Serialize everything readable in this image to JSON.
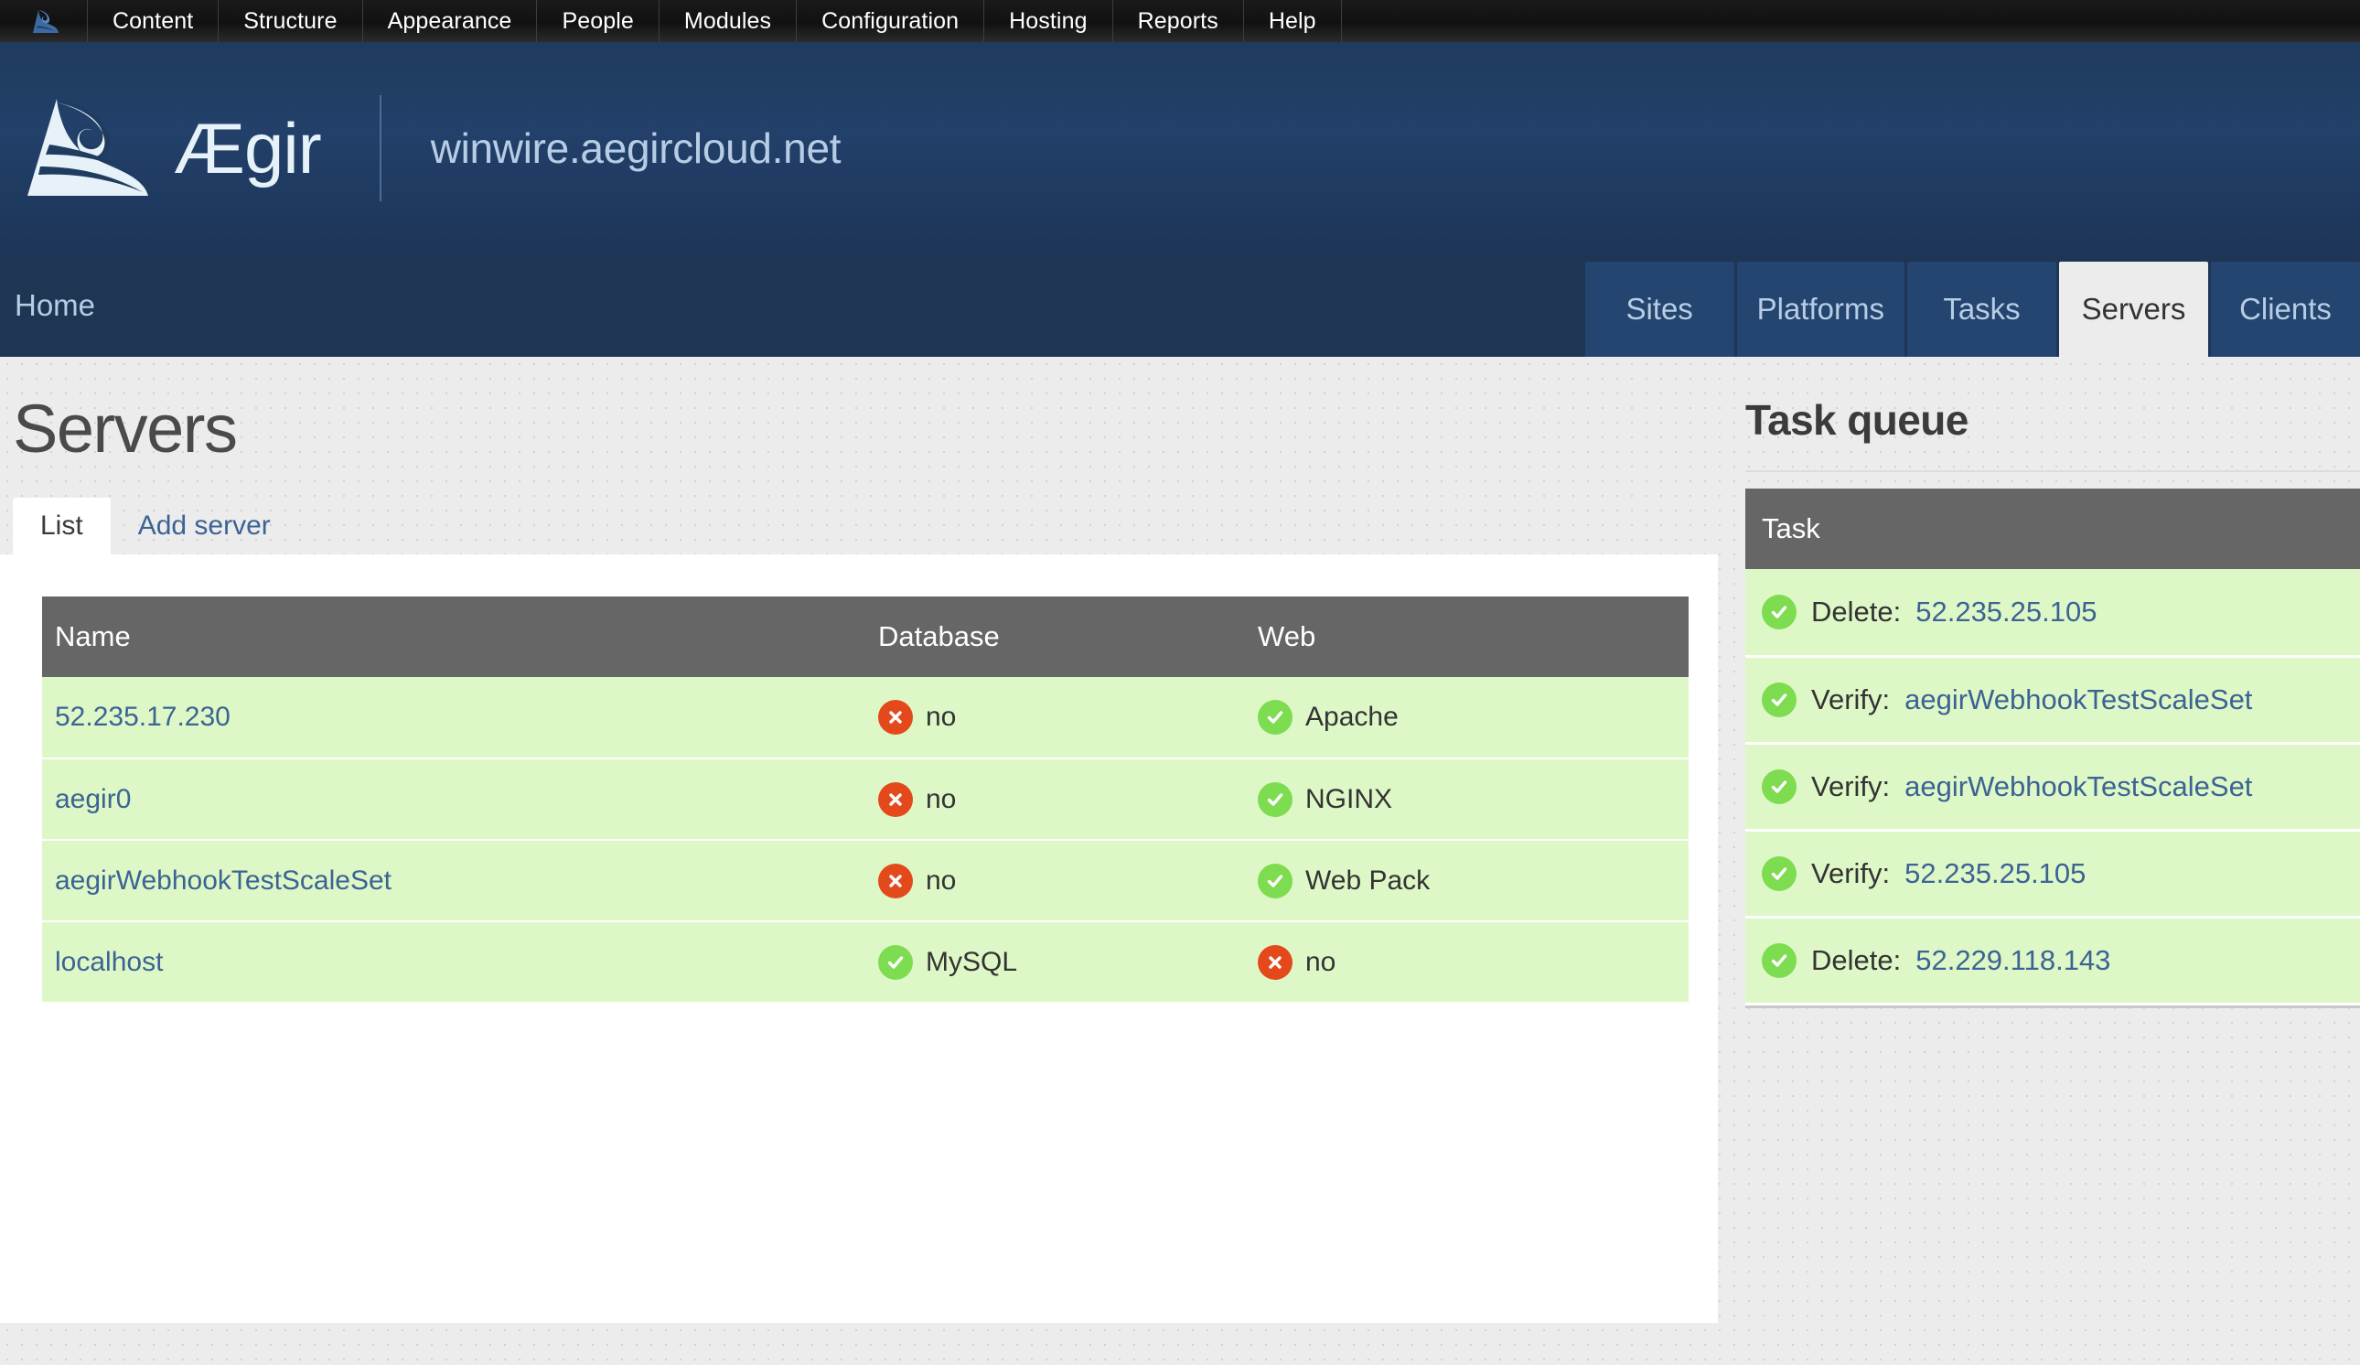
{
  "admin_toolbar": {
    "home_icon": "aegir-wave-logo-icon",
    "items": [
      {
        "label": "Content"
      },
      {
        "label": "Structure"
      },
      {
        "label": "Appearance"
      },
      {
        "label": "People"
      },
      {
        "label": "Modules"
      },
      {
        "label": "Configuration"
      },
      {
        "label": "Hosting"
      },
      {
        "label": "Reports"
      },
      {
        "label": "Help"
      }
    ]
  },
  "brand": {
    "logo_icon": "aegir-wave-logo-icon",
    "wordmark": "Ægir",
    "site_name": "winwire.aegircloud.net"
  },
  "nav": {
    "breadcrumb": "Home",
    "tabs": [
      {
        "label": "Sites",
        "active": false
      },
      {
        "label": "Platforms",
        "active": false
      },
      {
        "label": "Tasks",
        "active": false
      },
      {
        "label": "Servers",
        "active": true
      },
      {
        "label": "Clients",
        "active": false
      }
    ]
  },
  "page": {
    "title": "Servers",
    "local_tabs": [
      {
        "label": "List",
        "active": true
      },
      {
        "label": "Add server",
        "active": false
      }
    ]
  },
  "servers_table": {
    "columns": [
      "Name",
      "Database",
      "Web"
    ],
    "rows": [
      {
        "name": "52.235.17.230",
        "database_status": "no",
        "database_state": "no",
        "web_status": "Apache",
        "web_state": "yes"
      },
      {
        "name": "aegir0",
        "database_status": "no",
        "database_state": "no",
        "web_status": "NGINX",
        "web_state": "yes"
      },
      {
        "name": "aegirWebhookTestScaleSet",
        "database_status": "no",
        "database_state": "no",
        "web_status": "Web Pack",
        "web_state": "yes"
      },
      {
        "name": "localhost",
        "database_status": "MySQL",
        "database_state": "yes",
        "web_status": "no",
        "web_state": "no"
      }
    ]
  },
  "task_queue": {
    "title": "Task queue",
    "column": "Task",
    "items": [
      {
        "action": "Delete:",
        "target": "52.235.25.105",
        "state": "yes"
      },
      {
        "action": "Verify:",
        "target": "aegirWebhookTestScaleSet",
        "state": "yes"
      },
      {
        "action": "Verify:",
        "target": "aegirWebhookTestScaleSet",
        "state": "yes"
      },
      {
        "action": "Verify:",
        "target": "52.235.25.105",
        "state": "yes"
      },
      {
        "action": "Delete:",
        "target": "52.229.118.143",
        "state": "yes"
      }
    ]
  },
  "colors": {
    "brand_dark_blue": "#1e3553",
    "brand_blue": "#24456f",
    "link_blue": "#3c6394",
    "row_green": "#ddf8c6",
    "header_gray": "#666666",
    "status_yes": "#7ddc50",
    "status_no": "#e4491c"
  }
}
